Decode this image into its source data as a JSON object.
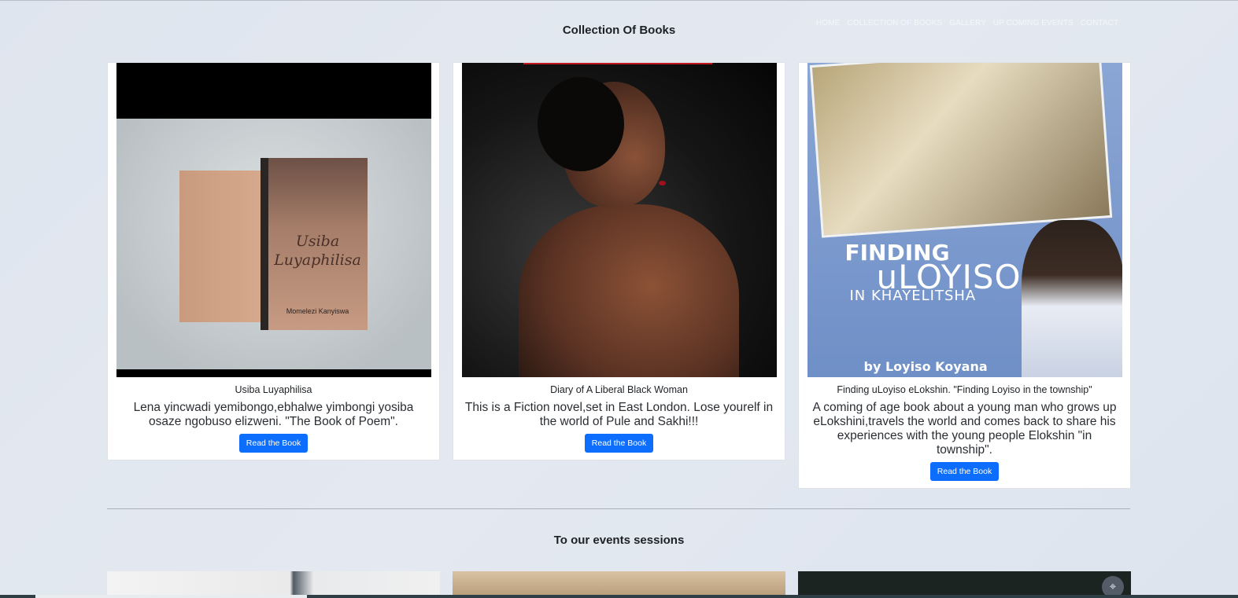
{
  "nav": {
    "items": [
      "HOME",
      "COLLECTION OF BOOKS",
      "GALLERY",
      "UP COMING EVENTS",
      "CONTACT"
    ]
  },
  "sections": {
    "books_title": "Collection Of Books",
    "events_title": "To our events sessions"
  },
  "books": [
    {
      "title": "Usiba Luyaphilisa",
      "description": "Lena yincwadi yemibongo,ebhalwe yimbongi yosiba osaze ngobuso elizweni. \"The Book of Poem\".",
      "button": "Read the Book",
      "cover_title": "Usiba Luyaphilisa",
      "cover_author": "Momelezi Kanyiswa"
    },
    {
      "title": "Diary of A Liberal Black Woman",
      "description": "This is a Fiction novel,set in East London. Lose yourelf in the world of Pule and Sakhi!!!",
      "button": "Read the Book"
    },
    {
      "title": "Finding uLoyiso eLokshin. \"Finding Loyiso in the township\"",
      "description": "A coming of age book about a young man who grows up eLokshini,travels the world and comes back to share his experiences with the young people Elokshin \"in township\".",
      "button": "Read the Book",
      "cover_line1": "FINDING",
      "cover_line2": "uLOYISO",
      "cover_line3": "IN KHAYELITSHA",
      "cover_by": "by Loyiso Koyana"
    }
  ],
  "colors": {
    "accent": "#0d6efd",
    "background": "#e0e6ef"
  }
}
